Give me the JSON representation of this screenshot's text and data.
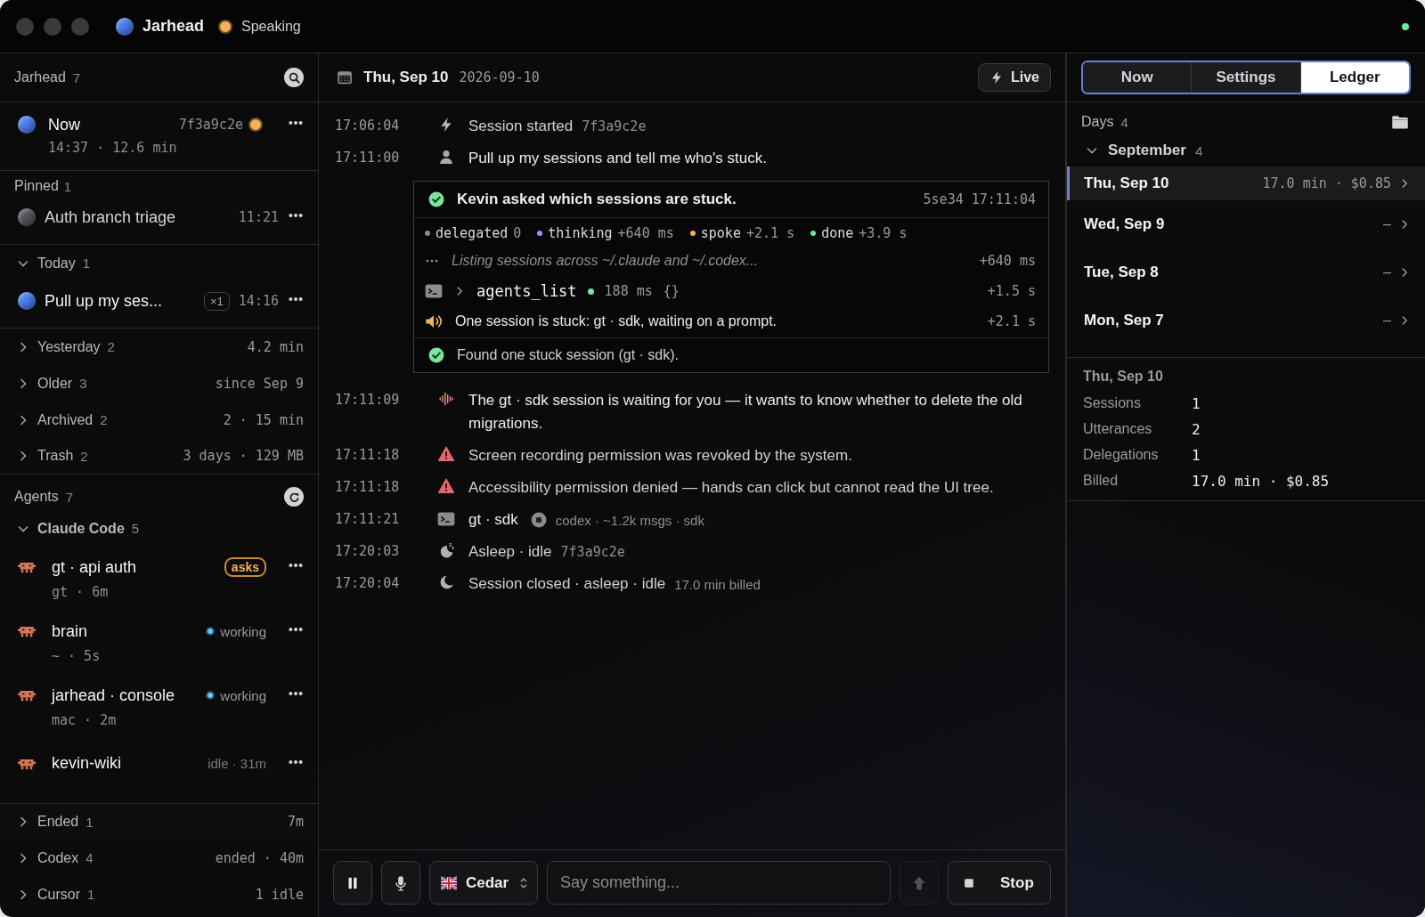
{
  "window": {
    "title": "Jarhead",
    "status": {
      "label": "Speaking",
      "color": "#f0b25a"
    },
    "connected": true
  },
  "sidebar": {
    "title": "Jarhead",
    "count": "7",
    "current": {
      "title": "Now",
      "hash": "7f3a9c2e",
      "meta": "14:37 · 12.6 min",
      "color": "#4d7ef2",
      "speaking": true
    },
    "pinned": {
      "label": "Pinned",
      "count": "1",
      "items": [
        {
          "title": "Auth branch triage",
          "time": "11:21",
          "color": "#55565b"
        }
      ]
    },
    "groups": [
      {
        "label": "Today",
        "count": "1",
        "expanded": true,
        "items": [
          {
            "title": "Pull up my ses...",
            "badge": "×1",
            "time": "14:16",
            "color": "#4d7ef2"
          }
        ]
      },
      {
        "label": "Yesterday",
        "count": "2",
        "expanded": false,
        "summary": "4.2 min"
      },
      {
        "label": "Older",
        "count": "3",
        "expanded": false,
        "summary": "since Sep 9"
      },
      {
        "label": "Archived",
        "count": "2",
        "expanded": false,
        "summary": "2 · 15 min"
      },
      {
        "label": "Trash",
        "count": "2",
        "expanded": false,
        "summary": "3 days · 129 MB"
      }
    ],
    "agents": {
      "title": "Agents",
      "count": "7",
      "groups": [
        {
          "label": "Claude Code",
          "count": "5",
          "expanded": true,
          "items": [
            {
              "name": "gt · api auth",
              "meta": "gt · 6m",
              "kind": "asks",
              "status": "asks"
            },
            {
              "name": "brain",
              "meta": "~ · 5s",
              "kind": "working",
              "status": "working"
            },
            {
              "name": "jarhead · console",
              "meta": "mac · 2m",
              "kind": "working",
              "status": "working"
            },
            {
              "name": "kevin-wiki",
              "kind": "idle",
              "status": "idle · 31m"
            }
          ]
        },
        {
          "label": "Ended",
          "count": "1",
          "expanded": false,
          "summary": "7m"
        },
        {
          "label": "Codex",
          "count": "4",
          "expanded": false,
          "summary": "ended · 40m"
        },
        {
          "label": "Cursor",
          "count": "1",
          "expanded": false,
          "summary": "1 idle"
        }
      ]
    }
  },
  "timeline": {
    "date": "Thu, Sep 10",
    "iso": "2026-09-10",
    "live_label": "Live",
    "events": [
      {
        "kind": "start",
        "time": "17:06:04",
        "text": "Session started",
        "detail": "7f3a9c2e"
      },
      {
        "kind": "user",
        "time": "17:11:00",
        "text": "Pull up my sessions and tell me who's stuck."
      },
      {
        "kind": "card",
        "title": "Kevin asked which sessions are stuck.",
        "ref": "5se34 17:11:04",
        "stages": [
          {
            "label": "delegated",
            "value": "0",
            "color": "#8a8a8f"
          },
          {
            "label": "thinking",
            "value": "+640 ms",
            "color": "#a78bfa"
          },
          {
            "label": "spoke",
            "value": "+2.1 s",
            "color": "#f0b25a"
          },
          {
            "label": "done",
            "value": "+3.9 s",
            "color": "#6ee7a0"
          }
        ],
        "steps": [
          {
            "kind": "thinking",
            "text": "Listing sessions across ~/.claude and ~/.codex...",
            "delta": "+640 ms"
          },
          {
            "kind": "tool",
            "name": "agents_list",
            "duration": "188 ms",
            "args": "{}",
            "delta": "+1.5 s"
          },
          {
            "kind": "speech",
            "text": "One session is stuck: gt · sdk, waiting on a prompt.",
            "delta": "+2.1 s"
          }
        ],
        "result": "Found one stuck session (gt · sdk)."
      },
      {
        "kind": "voice",
        "time": "17:11:09",
        "text": "The gt · sdk session is waiting for you — it wants to know whether to delete the old migrations."
      },
      {
        "kind": "warning",
        "time": "17:11:18",
        "text": "Screen recording permission was revoked by the system."
      },
      {
        "kind": "warning",
        "time": "17:11:18",
        "text": "Accessibility permission denied — hands can click but cannot read the UI tree."
      },
      {
        "kind": "terminal",
        "time": "17:11:21",
        "text": "gt · sdk",
        "detail": "codex · ~1.2k msgs · sdk"
      },
      {
        "kind": "asleep",
        "time": "17:20:03",
        "text": "Asleep · idle",
        "detail": "7f3a9c2e"
      },
      {
        "kind": "closed",
        "time": "17:20:04",
        "text": "Session closed · asleep · idle",
        "detail": "17.0 min billed"
      }
    ]
  },
  "composer": {
    "voice": "Cedar",
    "placeholder": "Say something...",
    "send_disabled": true,
    "stop_label": "Stop"
  },
  "ledger": {
    "tabs": [
      {
        "label": "Now",
        "selected": false
      },
      {
        "label": "Settings",
        "selected": false
      },
      {
        "label": "Ledger",
        "selected": true
      }
    ],
    "days_label": "Days",
    "days_count": "4",
    "month": "September",
    "month_count": "4",
    "month_expanded": true,
    "days": [
      {
        "label": "Thu, Sep 10",
        "summary": "17.0 min · $0.85",
        "selected": true
      },
      {
        "label": "Wed, Sep 9",
        "summary": "–",
        "selected": false
      },
      {
        "label": "Tue, Sep 8",
        "summary": "–",
        "selected": false
      },
      {
        "label": "Mon, Sep 7",
        "summary": "–",
        "selected": false
      }
    ],
    "detail": {
      "title": "Thu, Sep 10",
      "stats": [
        {
          "label": "Sessions",
          "value": "1"
        },
        {
          "label": "Utterances",
          "value": "2"
        },
        {
          "label": "Delegations",
          "value": "1"
        },
        {
          "label": "Billed",
          "value": "17.0 min · $0.85"
        }
      ]
    }
  }
}
